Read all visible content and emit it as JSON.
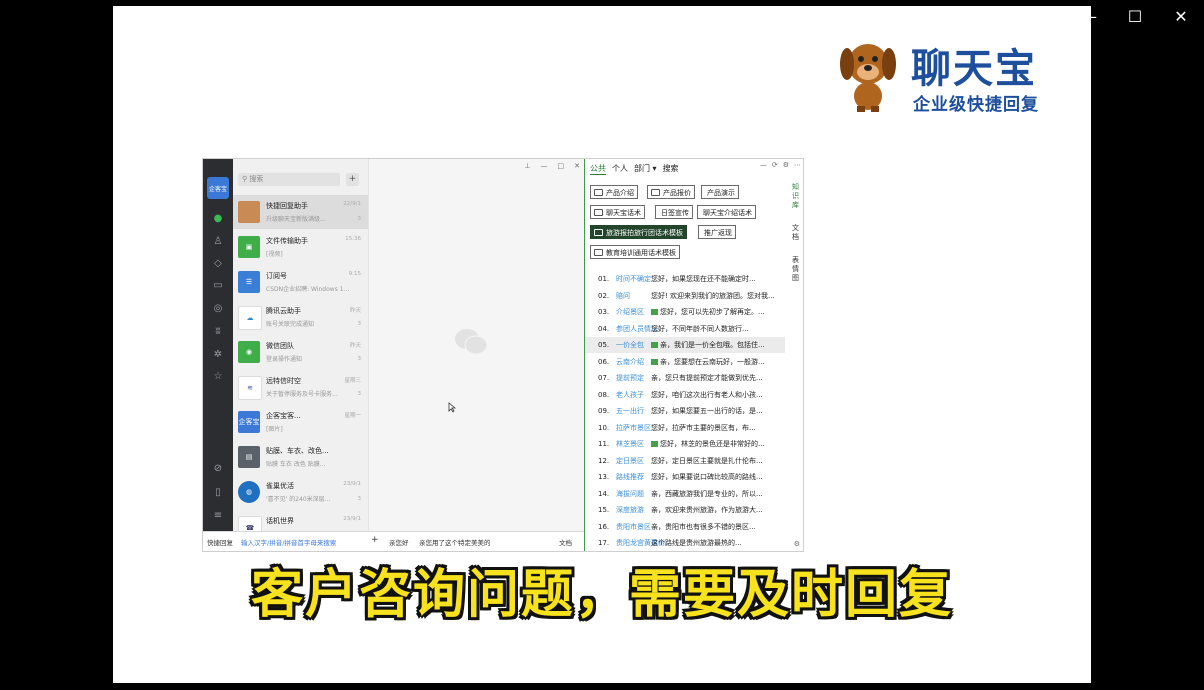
{
  "window_controls": {
    "minimize": "—",
    "maximize": "☐",
    "close": "✕"
  },
  "brand": {
    "title": "聊天宝",
    "subtitle": "企业级快捷回复"
  },
  "wecom": {
    "logo_text": "企客宝",
    "search_placeholder": "搜索",
    "add_button": "+",
    "chats": [
      {
        "name": "快捷回复助手",
        "preview": "升级聊天宝新版满级...",
        "time": "22/9/1",
        "num": "3"
      },
      {
        "name": "文件传输助手",
        "preview": "[视频]",
        "time": "15:36",
        "num": ""
      },
      {
        "name": "订阅号",
        "preview": "CSDN企业招聘: Windows 1...",
        "time": "9:15",
        "num": ""
      },
      {
        "name": "腾讯云助手",
        "preview": "账号关联完成通知",
        "time": "昨天",
        "num": "3"
      },
      {
        "name": "微信团队",
        "preview": "登录操作通知",
        "time": "昨天",
        "num": "3"
      },
      {
        "name": "远特信时空",
        "preview": "关于暂停服务及号卡服务...",
        "time": "星期三",
        "num": "3"
      },
      {
        "name": "企客宝客...",
        "preview": "[图片]",
        "time": "星期一",
        "num": ""
      },
      {
        "name": "贴膜、车衣、改色...",
        "preview": "贴膜 车衣 改色 贴膜...",
        "time": "",
        "num": ""
      },
      {
        "name": "雀巢优活",
        "preview": "'喜不见' 的240米深层...",
        "time": "23/9/1",
        "num": "3"
      },
      {
        "name": "话机世界",
        "preview": "",
        "time": "23/9/1",
        "num": ""
      }
    ],
    "bottom": {
      "label": "快捷回复",
      "input_hint": "输入汉字/拼音/拼音首字母来搜索",
      "plus": "+",
      "q1": "亲您好",
      "q2": "亲您用了这个特定美美的",
      "q3": "文档"
    }
  },
  "panel": {
    "tabs": [
      "公共",
      "个人",
      "部门 ▾",
      "搜索"
    ],
    "categories": [
      "产品介绍",
      "产品报价",
      "产品演示",
      "聊天宝话术",
      "日签宣传",
      "聊天宝介绍话术",
      "旅游报拍旅行团话术模板",
      "推广返现",
      "教育培训通用话术模板"
    ],
    "vertical_tabs": [
      "知识库",
      "文档",
      "表情图"
    ],
    "items": [
      {
        "num": "01.",
        "tag": "时间不确定",
        "pic": false,
        "text": "您好，如果您现在还不能确定时..."
      },
      {
        "num": "02.",
        "tag": "赔问",
        "pic": false,
        "text": "您好! 欢迎来到我们的旅游团。您对我..."
      },
      {
        "num": "03.",
        "tag": "介绍景区",
        "pic": true,
        "text": "您好，您可以先初步了解再定。..."
      },
      {
        "num": "04.",
        "tag": "参团人员情况",
        "pic": false,
        "text": "您好，不同年龄不同人数旅行..."
      },
      {
        "num": "05.",
        "tag": "一价全包",
        "pic": true,
        "text": "亲，我们是一价全包哦。包括住..."
      },
      {
        "num": "06.",
        "tag": "云南介绍",
        "pic": true,
        "text": "亲，您要想在云南玩好，一般游..."
      },
      {
        "num": "07.",
        "tag": "提前预定",
        "pic": false,
        "text": "亲，您只有提前预定才能做到优先..."
      },
      {
        "num": "08.",
        "tag": "老人孩子",
        "pic": false,
        "text": "您好，咱们这次出行有老人和小孩..."
      },
      {
        "num": "09.",
        "tag": "五一出行",
        "pic": false,
        "text": "您好，如果您要五一出行的话，是..."
      },
      {
        "num": "10.",
        "tag": "拉萨市景区",
        "pic": false,
        "text": "您好，拉萨市主要的景区有，布..."
      },
      {
        "num": "11.",
        "tag": "林芝景区",
        "pic": true,
        "text": "您好，林芝的景色还是非常好的..."
      },
      {
        "num": "12.",
        "tag": "定日景区",
        "pic": false,
        "text": "您好，定日景区主要就是扎什伦布..."
      },
      {
        "num": "13.",
        "tag": "路线推荐",
        "pic": false,
        "text": "您好，如果要说口碑比较高的路线..."
      },
      {
        "num": "14.",
        "tag": "海拔问题",
        "pic": false,
        "text": "亲，西藏旅游我们是专业的，所以..."
      },
      {
        "num": "15.",
        "tag": "深度旅游",
        "pic": false,
        "text": "亲，欢迎来贵州旅游，作为旅游大..."
      },
      {
        "num": "16.",
        "tag": "贵阳市景区",
        "pic": false,
        "text": "亲，贵阳市也有很多不错的景区..."
      },
      {
        "num": "17.",
        "tag": "贵阳龙宫黄果树",
        "pic": false,
        "text": "这个路线是贵州旅游最热的..."
      }
    ]
  },
  "caption": "客户咨询问题，需要及时回复"
}
